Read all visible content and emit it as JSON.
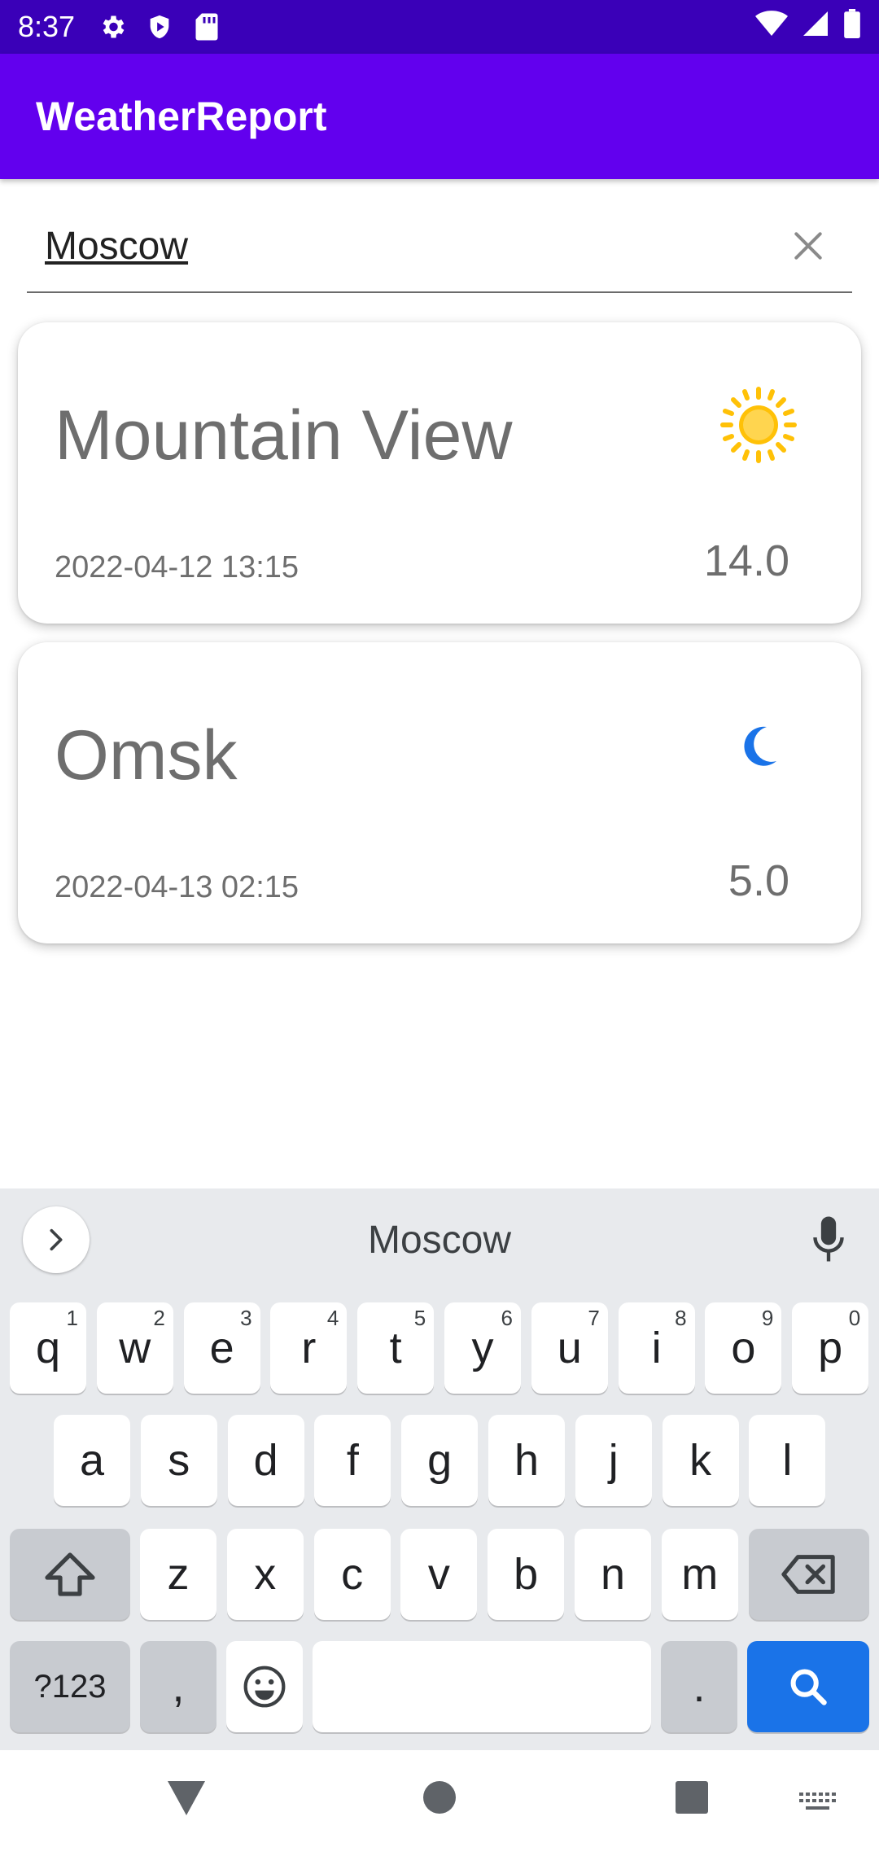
{
  "status_bar": {
    "time": "8:37"
  },
  "app_bar": {
    "title": "WeatherReport"
  },
  "search": {
    "value": "Moscow"
  },
  "cards": [
    {
      "city": "Mountain View",
      "date": "2022-04-12 13:15",
      "temp": "14.0",
      "icon": "sun-icon"
    },
    {
      "city": "Omsk",
      "date": "2022-04-13 02:15",
      "temp": "5.0",
      "icon": "moon-icon"
    }
  ],
  "keyboard": {
    "suggestion": "Moscow",
    "row1": [
      {
        "k": "q",
        "h": "1"
      },
      {
        "k": "w",
        "h": "2"
      },
      {
        "k": "e",
        "h": "3"
      },
      {
        "k": "r",
        "h": "4"
      },
      {
        "k": "t",
        "h": "5"
      },
      {
        "k": "y",
        "h": "6"
      },
      {
        "k": "u",
        "h": "7"
      },
      {
        "k": "i",
        "h": "8"
      },
      {
        "k": "o",
        "h": "9"
      },
      {
        "k": "p",
        "h": "0"
      }
    ],
    "row2": [
      "a",
      "s",
      "d",
      "f",
      "g",
      "h",
      "j",
      "k",
      "l"
    ],
    "row3": [
      "z",
      "x",
      "c",
      "v",
      "b",
      "n",
      "m"
    ],
    "symbols_label": "?123",
    "comma_label": ",",
    "period_label": "."
  },
  "colors": {
    "status_bar": "#3a00b8",
    "app_bar": "#6200ee",
    "search_key": "#1a73e8",
    "sun": "#ffc107",
    "moon": "#1a73e8"
  }
}
